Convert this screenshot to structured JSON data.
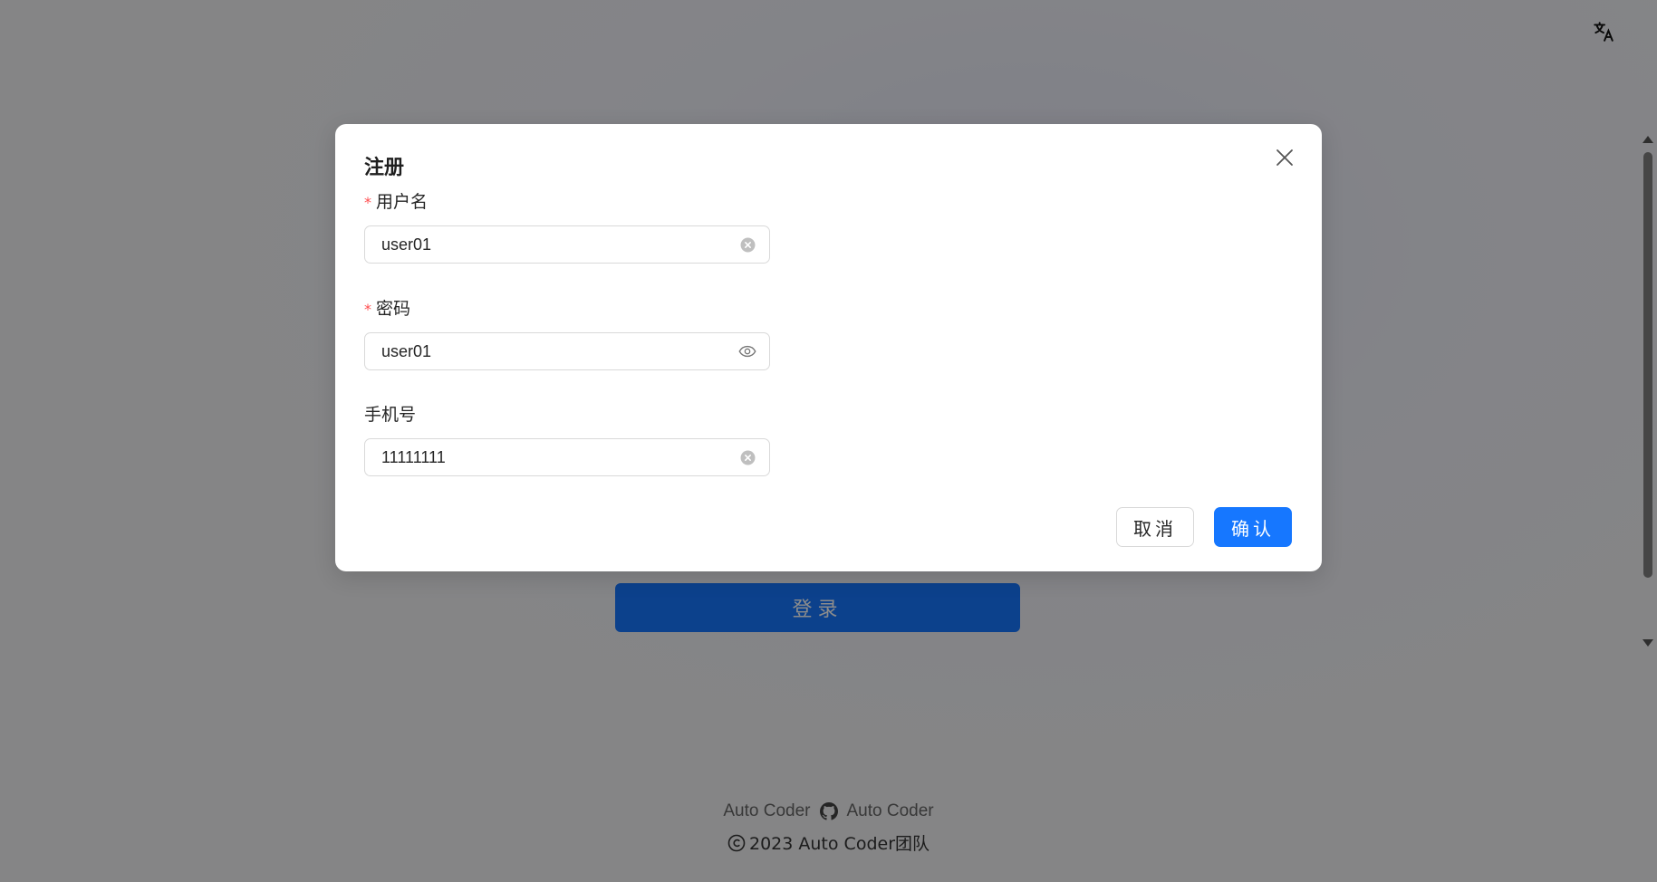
{
  "page": {
    "login_button_label": "登录",
    "footer": {
      "link_left": "Auto Coder",
      "link_right": "Auto Coder",
      "copyright": "2023 Auto Coder团队"
    }
  },
  "modal": {
    "title": "注册",
    "fields": [
      {
        "label": "用户名",
        "required": true,
        "value": "user01",
        "suffix_icon": "clear-icon"
      },
      {
        "label": "密码",
        "required": true,
        "value": "user01",
        "suffix_icon": "eye-icon"
      },
      {
        "label": "手机号",
        "required": false,
        "value": "11111111",
        "suffix_icon": "clear-icon"
      }
    ],
    "cancel_label": "取消",
    "confirm_label": "确认"
  },
  "colors": {
    "primary": "#1677ff",
    "required": "#ff4d4f",
    "mask": "rgba(0,0,0,0.45)"
  },
  "icons": {
    "language_toggle": "translate-icon",
    "close": "close-icon",
    "github": "github-icon",
    "copyright": "copyright-icon"
  }
}
